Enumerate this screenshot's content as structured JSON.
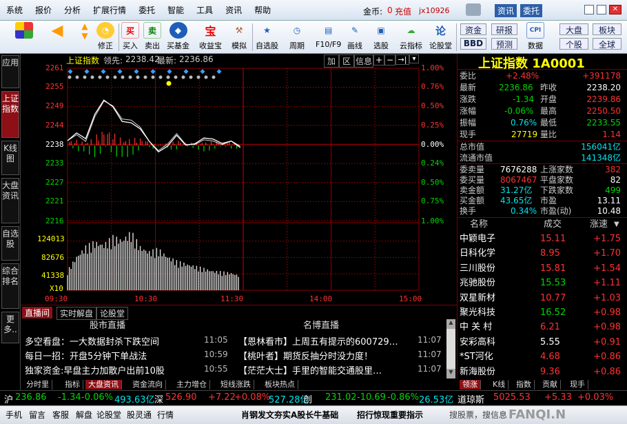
{
  "menubar": {
    "items": [
      "系统",
      "报价",
      "分析",
      "扩展行情",
      "委托",
      "智能",
      "工具",
      "资讯",
      "帮助"
    ],
    "coin_label": "金币:",
    "coin_value": "0",
    "recharge": "充值",
    "user": "jx10926",
    "zixun_btn": "资讯",
    "weituo_btn": "委托"
  },
  "toolbar": {
    "buttons": [
      "修正",
      "买入",
      "卖出",
      "买基金",
      "收益宝",
      "模拟",
      "自选股",
      "周期",
      "F10/F9",
      "画线",
      "选股",
      "云指标",
      "论股堂",
      "数据"
    ],
    "buy_glyph": "买",
    "sell_glyph": "卖",
    "bao_glyph": "宝",
    "lun_glyph": "论",
    "right_buttons": [
      "资金",
      "研报",
      "大盘",
      "板块",
      "BBD",
      "预测",
      "个股",
      "全球",
      "CPI"
    ]
  },
  "left_tabs": [
    "应用",
    "上证指数",
    "K线图",
    "大盘资讯",
    "自选股",
    "综合排名",
    "更多.."
  ],
  "chart": {
    "title": "上证指数",
    "lead_label": "领先:",
    "lead_value": "2238.42",
    "latest_label": "最新:",
    "latest_value": "2236.86",
    "toolbar": [
      "加",
      "区",
      "信息"
    ],
    "price_labels": [
      "2261",
      "2255",
      "2249",
      "2244",
      "2238",
      "2233",
      "2227",
      "2221",
      "2216"
    ],
    "pct_labels": [
      "1.00%",
      "0.76%",
      "0.50%",
      "0.25%",
      "0.00%",
      "0.24%",
      "0.50%",
      "0.75%",
      "1.00%"
    ],
    "volume_labels": [
      "124013",
      "82676",
      "41338",
      "X10"
    ],
    "time_labels": [
      "09:30",
      "10:30",
      "11:30",
      "14:00",
      "15:00"
    ],
    "colors": {
      "up": "#ff3232",
      "down": "#00d600",
      "price_line": "#ffffff",
      "avg_line": "#ffff00",
      "grid": "#8b0000"
    }
  },
  "chart_data": {
    "type": "line",
    "title": "上证指数",
    "x": [
      "09:30",
      "10:30",
      "11:30",
      "14:00",
      "15:00"
    ],
    "series": [
      {
        "values": [
          2239.6,
          2241.9,
          2240.2,
          2247.4,
          2251.6,
          2249.6,
          2245.3,
          2244.9,
          2243.1,
          2239.4,
          2236.3,
          2238.0,
          2241.2,
          2238.3,
          2238.7,
          2240.4,
          2240.1,
          2238.8,
          2239.5,
          2237.6
        ]
      }
    ],
    "ylim": [
      2216,
      2261
    ],
    "volume": [
      40,
      70,
      90,
      100,
      95,
      110,
      105,
      120,
      90,
      80,
      85,
      70,
      60,
      55,
      50,
      45,
      40,
      38,
      36,
      30
    ],
    "ylabel": "",
    "xlabel": ""
  },
  "news": {
    "tabs": [
      "直播间",
      "实时解盘",
      "论股堂"
    ],
    "left_header": "股市直播",
    "right_header": "名博直播",
    "left_items": [
      {
        "text": "多空看盘：一大数据封杀下跌空间",
        "time": "11:05"
      },
      {
        "text": "每日一招：开盘5分钟下单战法",
        "time": "10:59"
      },
      {
        "text": "独家资金:早盘主力加散户出前10股",
        "time": "10:55"
      }
    ],
    "right_items": [
      {
        "text": "【恩林看市】上周五有提示的600729…",
        "time": "11:07"
      },
      {
        "text": "【桃叶者】期货反抽分时没力度！",
        "time": "11:07"
      },
      {
        "text": "【茫茫大士】手里的智能交通股里…",
        "time": "11:07"
      }
    ]
  },
  "bottom_tabs": [
    "分时里",
    "指标",
    "大盘资讯",
    "资金流向",
    "主力增仓",
    "短线涨跌",
    "板块热点"
  ],
  "quote": {
    "title": "上证指数 1A0001",
    "rows": [
      {
        "l": "委比",
        "v1": "+2.48%",
        "l2": "",
        "v2": "+391178"
      },
      {
        "l": "最新",
        "v1": "2236.86",
        "l2": "昨收",
        "v2": "2238.20"
      },
      {
        "l": "涨跌",
        "v1": "-1.34",
        "l2": "开盘",
        "v2": "2239.86"
      },
      {
        "l": "涨幅",
        "v1": "-0.06%",
        "l2": "最高",
        "v2": "2250.50"
      },
      {
        "l": "振幅",
        "v1": "0.76%",
        "l2": "最低",
        "v2": "2233.55"
      },
      {
        "l": "现手",
        "v1": "27719",
        "l2": "量比",
        "v2": "1.14"
      }
    ],
    "cap_rows": [
      {
        "l": "总市值",
        "v": "156041亿"
      },
      {
        "l": "流通市值",
        "v": "141348亿"
      }
    ],
    "flow_rows": [
      {
        "l": "委卖量",
        "v1": "7676288",
        "l2": "上涨家数",
        "v2": "382"
      },
      {
        "l": "委买量",
        "v1": "8067467",
        "l2": "平盘家数",
        "v2": "82"
      },
      {
        "l": "卖金额",
        "v1": "31.27亿",
        "l2": "下跌家数",
        "v2": "499"
      },
      {
        "l": "买金额",
        "v1": "43.65亿",
        "l2": "市盈",
        "v2": "13.11"
      },
      {
        "l": "换手",
        "v1": "0.34%",
        "l2": "市盈(动)",
        "v2": "10.48"
      }
    ],
    "list_header": [
      "名称",
      "成交",
      "涨速"
    ],
    "stocks": [
      {
        "name": "中颖电子",
        "price": "15.11",
        "chg": "+1.75"
      },
      {
        "name": "日科化学",
        "price": "8.95",
        "chg": "+1.70"
      },
      {
        "name": "三川股份",
        "price": "15.81",
        "chg": "+1.54"
      },
      {
        "name": "兆驰股份",
        "price": "15.53",
        "chg": "+1.11"
      },
      {
        "name": "双星新材",
        "price": "10.77",
        "chg": "+1.03"
      },
      {
        "name": "聚光科技",
        "price": "16.52",
        "chg": "+0.98"
      },
      {
        "name": "中 关 村",
        "price": "6.21",
        "chg": "+0.98"
      },
      {
        "name": "安彩高科",
        "price": "5.55",
        "chg": "+0.91"
      },
      {
        "name": "*ST河化",
        "price": "4.68",
        "chg": "+0.86"
      },
      {
        "name": "新海股份",
        "price": "9.36",
        "chg": "+0.86"
      }
    ],
    "tabs": [
      "领涨",
      "K线",
      "指数",
      "贡献",
      "现手"
    ]
  },
  "ticker": {
    "sh_label": "沪",
    "sh_val": "236.86",
    "sh_chg": "-1.34",
    "sh_pct": "-0.06%",
    "sh_amt": "493.63亿",
    "sz_label": "深",
    "sz_val": "526.90",
    "sz_chg": "+7.22",
    "sz_pct": "+0.08%",
    "sz_amt": "527.28亿",
    "cy_label": "创",
    "cy_val": "231.02",
    "cy_chg": "-10.69",
    "cy_pct": "-0.86%",
    "cy_amt": "26.53亿",
    "dj_label": "道琼斯",
    "dj_val": "5025.53",
    "dj_chg": "+5.33",
    "dj_pct": "+0.03%"
  },
  "status": {
    "items": [
      "手机",
      "留言",
      "客服",
      "解盘",
      "论股堂",
      "股灵通",
      "行情"
    ],
    "marquee1": "肖钢发文夯实A股长牛基础",
    "marquee2": "招行惊现重要指示",
    "search": "搜股票，搜信息",
    "watermark": "FANQI.N"
  }
}
